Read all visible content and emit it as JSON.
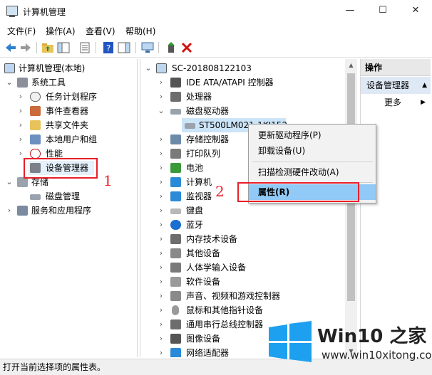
{
  "window": {
    "title": "计算机管理",
    "minimize": "—",
    "maximize": "☐",
    "close": "✕"
  },
  "menu": {
    "file": "文件(F)",
    "action": "操作(A)",
    "view": "查看(V)",
    "help": "帮助(H)"
  },
  "left_tree": {
    "root": "计算机管理(本地)",
    "system_tools": "系统工具",
    "task_scheduler": "任务计划程序",
    "event_viewer": "事件查看器",
    "shared_folders": "共享文件夹",
    "local_users": "本地用户和组",
    "performance": "性能",
    "device_manager": "设备管理器",
    "storage": "存储",
    "disk_management": "磁盘管理",
    "services_apps": "服务和应用程序"
  },
  "device_tree": {
    "computer_name": "SC-201808122103",
    "categories": [
      "IDE ATA/ATAPI 控制器",
      "处理器",
      "磁盘驱动器",
      "ST500LM021-1KJ152",
      "存储控制器",
      "打印队列",
      "电池",
      "计算机",
      "监视器",
      "键盘",
      "蓝牙",
      "内存技术设备",
      "其他设备",
      "人体学输入设备",
      "软件设备",
      "声音、视频和游戏控制器",
      "鼠标和其他指针设备",
      "通用串行总线控制器",
      "图像设备",
      "网络适配器"
    ]
  },
  "context_menu": {
    "update_driver": "更新驱动程序(P)",
    "uninstall": "卸载设备(U)",
    "scan": "扫描检测硬件改动(A)",
    "properties": "属性(R)"
  },
  "actions": {
    "header": "操作",
    "section": "设备管理器",
    "more": "更多"
  },
  "annotations": {
    "one": "1",
    "two": "2"
  },
  "status": "打开当前选择项的属性表。",
  "watermark": {
    "title": "Win10 之家",
    "url": "www.win10xitong.com"
  },
  "colors": {
    "accent": "#0078d7",
    "annotation": "#e8202a",
    "highlight": "#91c9f7"
  }
}
